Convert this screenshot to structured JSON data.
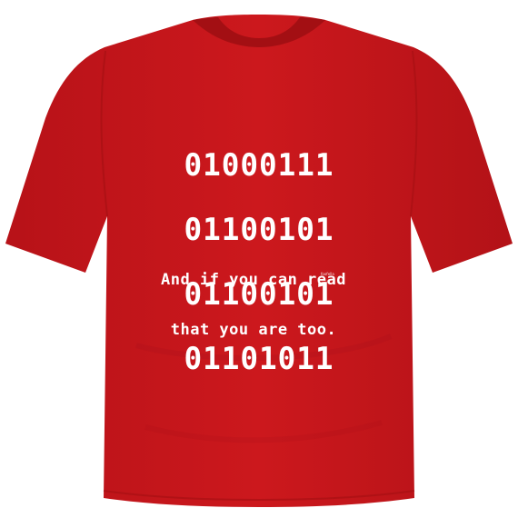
{
  "colors": {
    "shirt": "#c8161b",
    "shirt_shadow": "#a30f13",
    "print": "#ffffff",
    "background": "#ffffff"
  },
  "print": {
    "binary_lines": [
      "01000111",
      "01100101",
      "01100101",
      "01101011"
    ],
    "tagline_lines": [
      "And if you can read",
      "that you are too."
    ],
    "brand": "foofella"
  }
}
